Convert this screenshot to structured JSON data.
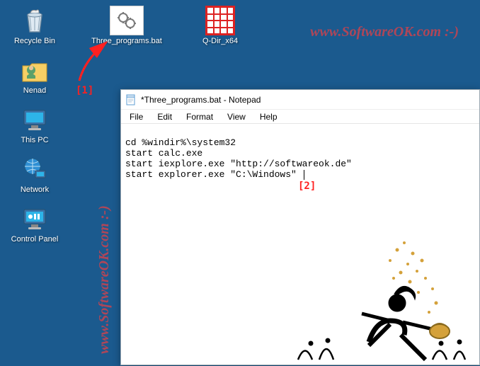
{
  "desktop": {
    "icons": [
      {
        "name": "recycle-bin",
        "label": "Recycle Bin"
      },
      {
        "name": "user-folder",
        "label": "Nenad"
      },
      {
        "name": "this-pc",
        "label": "This PC"
      },
      {
        "name": "network",
        "label": "Network"
      },
      {
        "name": "control-panel",
        "label": "Control Panel"
      }
    ],
    "top_row": [
      {
        "name": "batch-file",
        "label": "Three_programs.bat"
      },
      {
        "name": "qdir-shortcut",
        "label": "Q-Dir_x64"
      }
    ]
  },
  "annotations": {
    "one": "[1]",
    "two": "[2]"
  },
  "watermark": "www.SoftwareOK.com :-)",
  "notepad": {
    "title": "*Three_programs.bat - Notepad",
    "menu": [
      "File",
      "Edit",
      "Format",
      "View",
      "Help"
    ],
    "lines": [
      "cd %windir%\\system32",
      "start calc.exe",
      "start iexplore.exe \"http://softwareok.de\"",
      "start explorer.exe \"C:\\Windows\" "
    ]
  }
}
